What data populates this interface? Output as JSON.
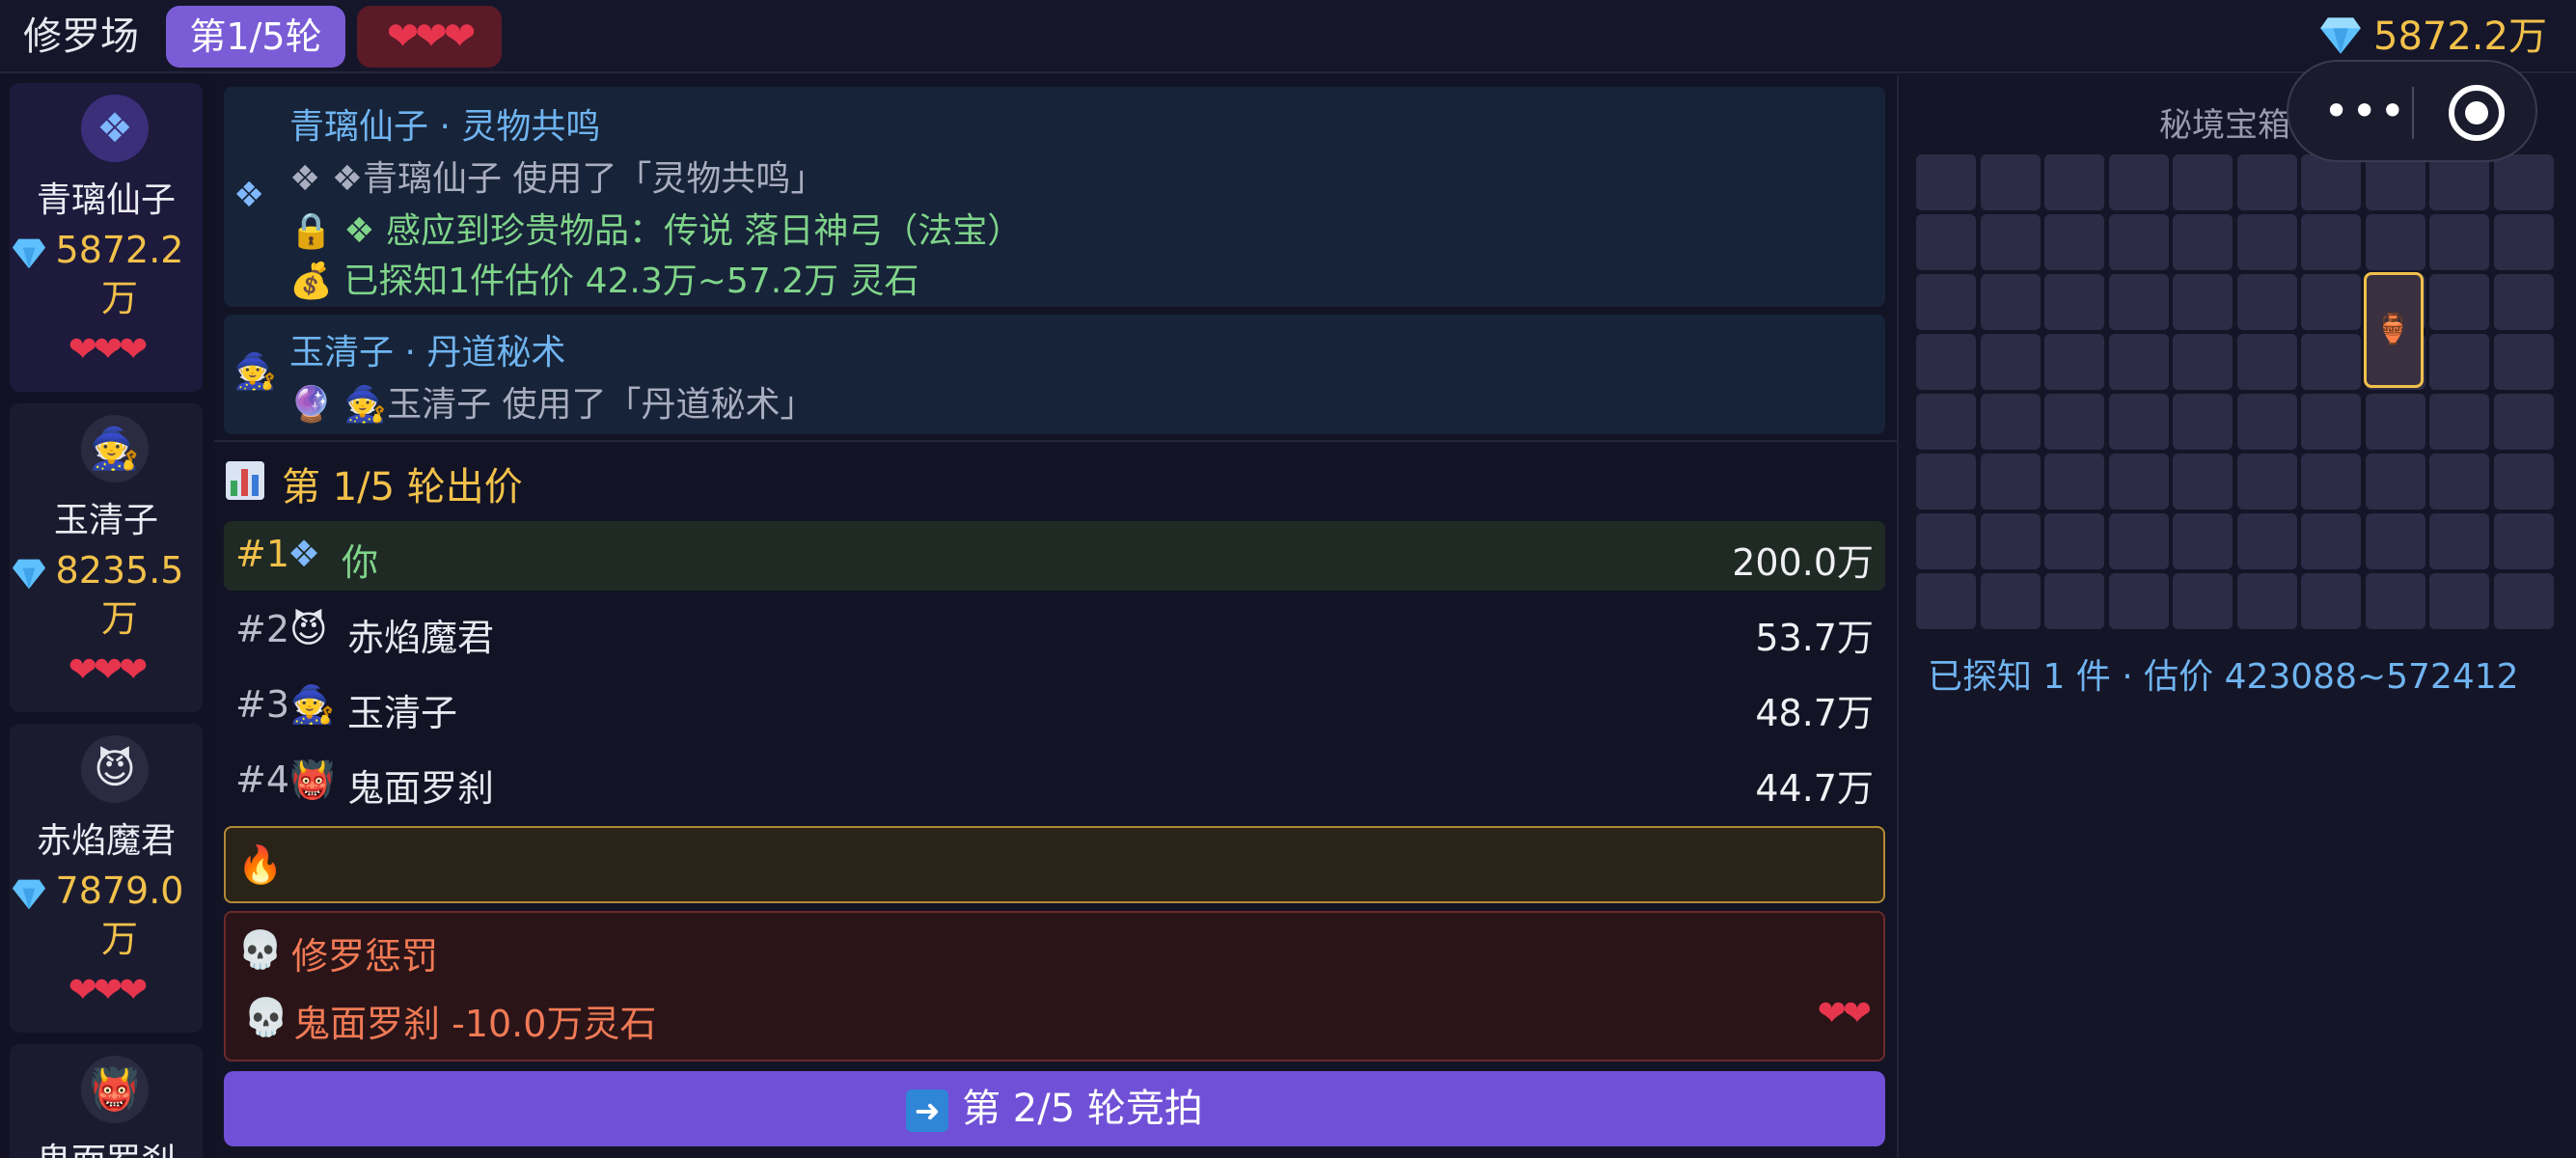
{
  "topbar": {
    "title": "修罗场",
    "round": "第1/5轮",
    "lives": "❤❤❤",
    "currency": "5872.2万"
  },
  "players": [
    {
      "name": "青璃仙子",
      "avatar": "❖",
      "money": "5872.2万",
      "lives": "❤❤❤"
    },
    {
      "name": "玉清子",
      "avatar": "🧙",
      "money": "8235.5万",
      "lives": "❤❤❤"
    },
    {
      "name": "赤焰魔君",
      "avatar": "😈",
      "money": "7879.0万",
      "lives": "❤❤❤"
    },
    {
      "name": "鬼面罗刹",
      "avatar": "👹"
    }
  ],
  "logs": [
    {
      "side_icon": "❖",
      "title": "青璃仙子 · 灵物共鸣",
      "lines": [
        "❖ ❖青璃仙子 使用了「灵物共鸣」",
        "🔒 ❖ 感应到珍贵物品：传说 落日神弓（法宝）",
        "💰 已探知1件估价 42.3万~57.2万 灵石"
      ]
    },
    {
      "side_icon": "🧙",
      "title": "玉清子 · 丹道秘术",
      "lines": [
        "🔮 🧙玉清子 使用了「丹道秘术」"
      ]
    }
  ],
  "bids": {
    "header": "第 1/5 轮出价",
    "rows": [
      {
        "rank": "#1",
        "emoji": "❖",
        "name": "你",
        "amount": "200.0万"
      },
      {
        "rank": "#2",
        "emoji": "😈",
        "name": "赤焰魔君",
        "amount": "53.7万"
      },
      {
        "rank": "#3",
        "emoji": "🧙",
        "name": "玉清子",
        "amount": "48.7万"
      },
      {
        "rank": "#4",
        "emoji": "👹",
        "name": "鬼面罗刹",
        "amount": "44.7万"
      }
    ]
  },
  "fire_icon": "🔥",
  "punish": {
    "icon": "💀",
    "title": "修罗惩罚",
    "line": "鬼面罗刹 -10.0万灵石",
    "lives": "❤❤"
  },
  "next_button": "第 2/5 轮竞拍",
  "chest": {
    "title": "秘境宝箱",
    "cols": 10,
    "rows": 8,
    "item_icon": "🏺",
    "known_text": "已探知 1 件 · 估价 423088~572412"
  },
  "capsule": {
    "more": "•••"
  },
  "colors": {
    "accent": "#7a5cd6",
    "gold": "#f2c14a",
    "heart": "#e8354e",
    "blue": "#6fb4f0",
    "green": "#7fd48a"
  }
}
